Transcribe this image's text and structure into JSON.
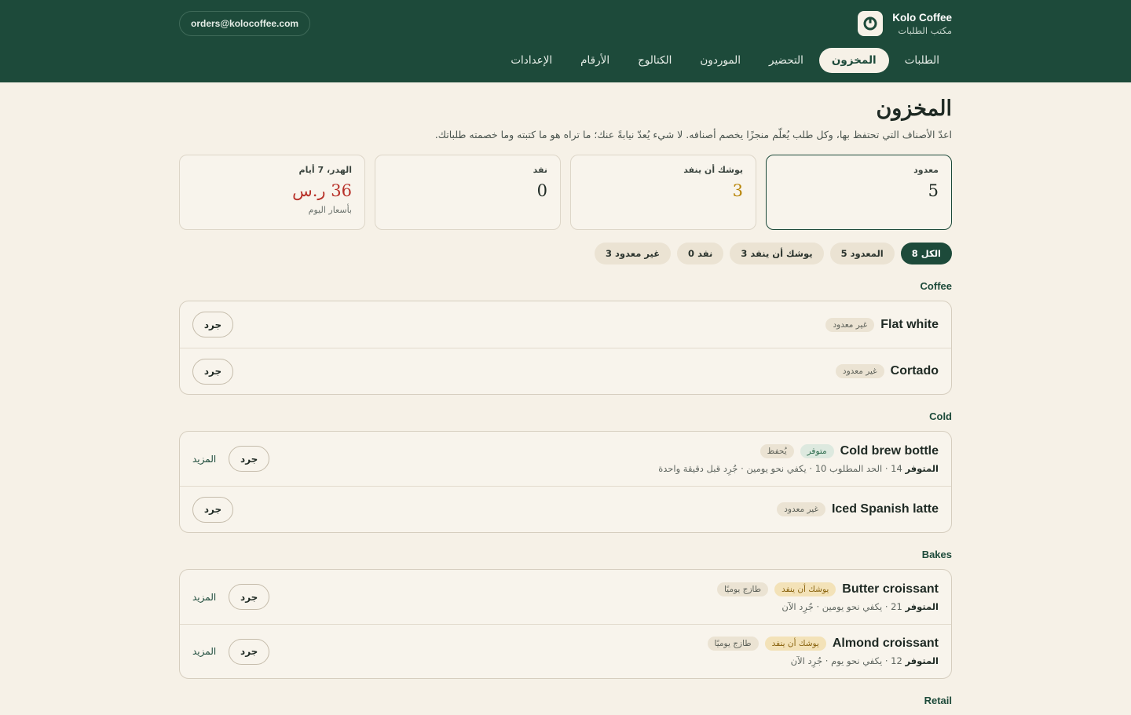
{
  "brand": {
    "name": "Kolo Coffee",
    "subtitle": "مكتب الطلبات"
  },
  "account": {
    "email": "orders@kolocoffee.com"
  },
  "nav": [
    {
      "label": "الطلبات",
      "active": false
    },
    {
      "label": "المخزون",
      "active": true
    },
    {
      "label": "التحضير",
      "active": false
    },
    {
      "label": "الموردون",
      "active": false
    },
    {
      "label": "الكتالوج",
      "active": false
    },
    {
      "label": "الأرقام",
      "active": false
    },
    {
      "label": "الإعدادات",
      "active": false
    }
  ],
  "page": {
    "title": "المخزون",
    "description": "اعدّ الأصناف التي تحتفظ بها، وكل طلب يُعلّم منجزًا يخصم أصنافه. لا شيء يُعدّ نيابةً عنك؛ ما تراه هو ما كتبته وما خصمته طلباتك."
  },
  "stats": [
    {
      "label": "معدود",
      "value": "5",
      "color": "#1f2a24"
    },
    {
      "label": "يوشك أن ينفد",
      "value": "3",
      "color": "#b8860b"
    },
    {
      "label": "نفد",
      "value": "0",
      "color": "#1f2a24"
    },
    {
      "label": "الهدر، 7 أيام",
      "value": "36 ر.س",
      "sub": "بأسعار اليوم",
      "color": "#b8322a"
    }
  ],
  "filters": [
    {
      "label": "الكل 8",
      "active": true
    },
    {
      "label": "المعدود 5",
      "active": false
    },
    {
      "label": "يوشك أن ينفد 3",
      "active": false
    },
    {
      "label": "نفد 0",
      "active": false
    },
    {
      "label": "غير معدود 3",
      "active": false
    }
  ],
  "actions": {
    "count": "جرد",
    "more": "المزيد"
  },
  "meta_label": "المتوفر",
  "sections": {
    "coffee": {
      "title": "Coffee",
      "items": [
        {
          "name": "Flat white",
          "tag": "غير معدود"
        },
        {
          "name": "Cortado",
          "tag": "غير معدود"
        }
      ]
    },
    "cold": {
      "title": "Cold",
      "items": [
        {
          "name": "Cold brew bottle",
          "tag": "متوفر",
          "tag2": "يُحفظ",
          "qty": "14",
          "meta": "· الحد المطلوب 10 · يكفي نحو يومين · جُرِد قبل دقيقة واحدة"
        },
        {
          "name": "Iced Spanish latte",
          "tag": "غير معدود"
        }
      ]
    },
    "bakes": {
      "title": "Bakes",
      "items": [
        {
          "name": "Butter croissant",
          "tag": "يوشك أن ينفد",
          "tag2": "طازج يوميًا",
          "qty": "21",
          "meta": "· يكفي نحو يومين · جُرِد الآن"
        },
        {
          "name": "Almond croissant",
          "tag": "يوشك أن ينفد",
          "tag2": "طازج يوميًا",
          "qty": "12",
          "meta": "· يكفي نحو يوم · جُرِد الآن"
        }
      ]
    },
    "retail": {
      "title": "Retail"
    }
  }
}
